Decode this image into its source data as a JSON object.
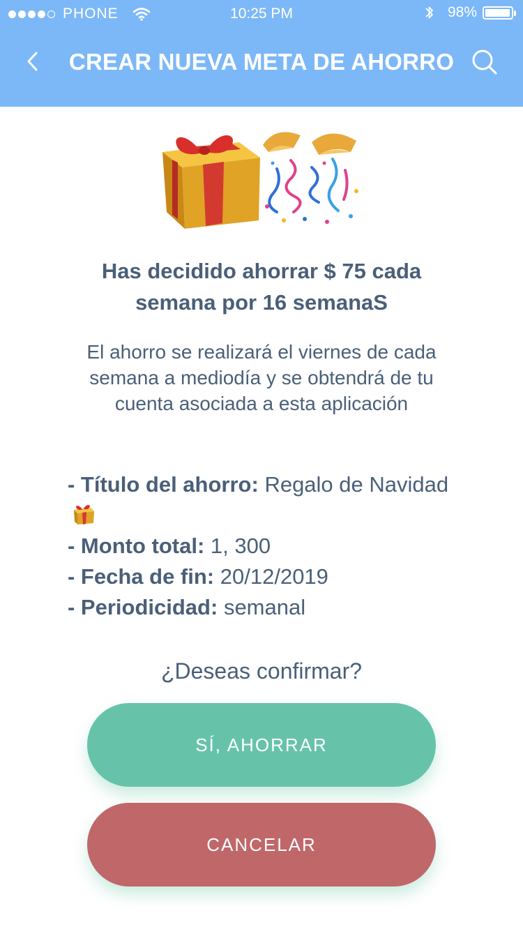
{
  "status_bar": {
    "carrier": "PHONE",
    "time": "10:25 PM",
    "battery": "98%",
    "battery_level": 0.98,
    "icons": [
      "signal-dots-icon",
      "wifi-icon",
      "bluetooth-icon",
      "battery-icon"
    ]
  },
  "nav": {
    "title": "CREAR NUEVA META DE AHORRO",
    "back_icon": "chevron-left-icon",
    "search_icon": "search-icon"
  },
  "illustration": {
    "icons": [
      "gift-icon",
      "party-popper-confetti-icon"
    ]
  },
  "summary": {
    "headline_line1": "Has decidido ahorrar $ 75 cada",
    "headline_line2": "semana por 16 semanaS",
    "description": "El ahorro se realizará el viernes de cada semana a mediodía y se obtendrá de tu cuenta asociada a esta aplicación"
  },
  "details": {
    "title_label": "- Título del ahorro:",
    "title_value": "Regalo de Navidad",
    "title_icon": "gift-icon",
    "amount_label": "- Monto total:",
    "amount_value": "1, 300",
    "end_label": "- Fecha de fin:",
    "end_value": "20/12/2019",
    "period_label": "- Periodicidad:",
    "period_value": "semanal"
  },
  "confirm": {
    "question": "¿Deseas confirmar?",
    "confirm_label": "SÍ, AHORRAR",
    "cancel_label": "CANCELAR"
  },
  "colors": {
    "header": "#7cb8f7",
    "text": "#4a5f78",
    "confirm_button": "#66c3a9",
    "cancel_button": "#c0676a"
  }
}
